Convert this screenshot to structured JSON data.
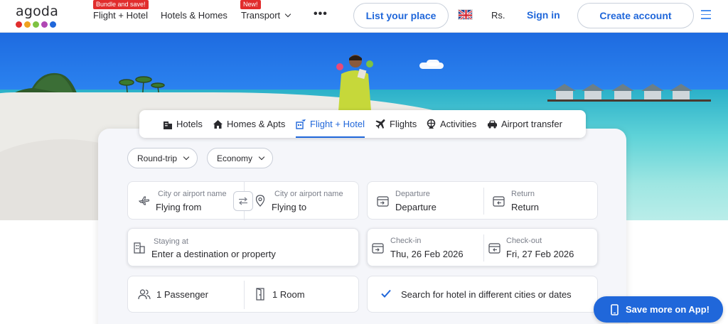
{
  "header": {
    "logo_text": "agoda",
    "logo_colors": [
      "#e12d2d",
      "#f0a21f",
      "#7ec242",
      "#b047b4",
      "#2067da"
    ],
    "nav": [
      {
        "label": "Flight + Hotel",
        "badge": "Bundle and save!"
      },
      {
        "label": "Hotels & Homes"
      },
      {
        "label": "Transport",
        "badge": "New!"
      }
    ],
    "more_label": "•••",
    "list_place_label": "List your place",
    "currency": "Rs.",
    "signin_label": "Sign in",
    "create_account_label": "Create account"
  },
  "tabs": [
    {
      "label": "Hotels",
      "icon": "hotel-icon"
    },
    {
      "label": "Homes & Apts",
      "icon": "home-icon"
    },
    {
      "label": "Flight + Hotel",
      "icon": "flight-hotel-icon",
      "active": true
    },
    {
      "label": "Flights",
      "icon": "plane-icon"
    },
    {
      "label": "Activities",
      "icon": "activities-icon"
    },
    {
      "label": "Airport transfer",
      "icon": "car-icon"
    }
  ],
  "search": {
    "trip_type": "Round-trip",
    "cabin_class": "Economy",
    "from": {
      "label": "City or airport name",
      "value": "Flying from"
    },
    "to": {
      "label": "City or airport name",
      "value": "Flying to"
    },
    "departure": {
      "label": "Departure",
      "value": "Departure"
    },
    "return": {
      "label": "Return",
      "value": "Return"
    },
    "staying": {
      "label": "Staying at",
      "value": "Enter a destination or property"
    },
    "checkin": {
      "label": "Check-in",
      "value": "Thu, 26 Feb 2026"
    },
    "checkout": {
      "label": "Check-out",
      "value": "Fri, 27 Feb 2026"
    },
    "passengers": "1 Passenger",
    "rooms": "1 Room",
    "different_cities_label": "Search for hotel in different cities or dates",
    "different_cities_checked": true
  },
  "app_button_label": "Save more on App!",
  "colors": {
    "accent": "#2067da",
    "badge": "#e12d2d"
  }
}
